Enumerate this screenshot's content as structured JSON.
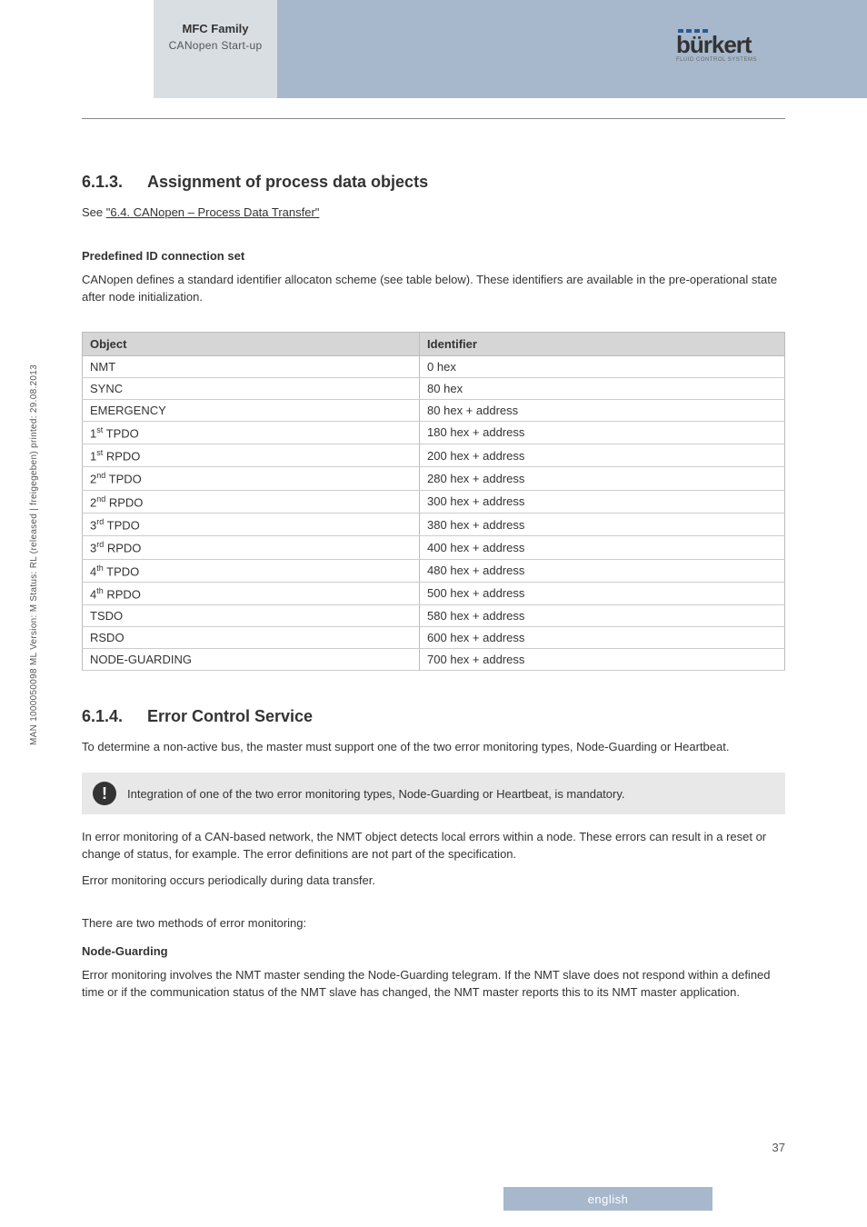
{
  "header": {
    "title": "MFC Family",
    "subtitle": "CANopen Start-up",
    "logo_word": "bürkert",
    "logo_sub": "FLUID CONTROL SYSTEMS"
  },
  "side_text": "MAN 1000050098 ML Version: M Status: RL (released | freigegeben) printed: 29.08.2013",
  "sec613": {
    "num": "6.1.3.",
    "title": "Assignment of process data objects",
    "see_label": "See ",
    "see_link": "\"6.4. CANopen – Process Data Transfer\"",
    "predefined_heading": "Predefined ID connection set",
    "predefined_text": "CANopen defines a standard identifier allocaton scheme (see table below). These identifiers are available in the pre-operational state after node initialization."
  },
  "table": {
    "head_object": "Object",
    "head_identifier": "Identifier",
    "rows": [
      {
        "obj_pre": "",
        "obj_sup": "",
        "obj_post": "NMT",
        "id": "0 hex"
      },
      {
        "obj_pre": "",
        "obj_sup": "",
        "obj_post": "SYNC",
        "id": "80 hex"
      },
      {
        "obj_pre": "",
        "obj_sup": "",
        "obj_post": "EMERGENCY",
        "id": "80 hex + address"
      },
      {
        "obj_pre": "1",
        "obj_sup": "st",
        "obj_post": " TPDO",
        "id": "180 hex + address"
      },
      {
        "obj_pre": "1",
        "obj_sup": "st",
        "obj_post": " RPDO",
        "id": "200 hex + address"
      },
      {
        "obj_pre": "2",
        "obj_sup": "nd",
        "obj_post": " TPDO",
        "id": "280 hex + address"
      },
      {
        "obj_pre": "2",
        "obj_sup": "nd",
        "obj_post": " RPDO",
        "id": "300 hex + address"
      },
      {
        "obj_pre": "3",
        "obj_sup": "rd",
        "obj_post": " TPDO",
        "id": "380 hex + address"
      },
      {
        "obj_pre": "3",
        "obj_sup": "rd",
        "obj_post": " RPDO",
        "id": "400 hex + address"
      },
      {
        "obj_pre": "4",
        "obj_sup": "th",
        "obj_post": " TPDO",
        "id": "480 hex + address"
      },
      {
        "obj_pre": "4",
        "obj_sup": "th",
        "obj_post": " RPDO",
        "id": "500 hex + address"
      },
      {
        "obj_pre": "",
        "obj_sup": "",
        "obj_post": "TSDO",
        "id": "580 hex + address"
      },
      {
        "obj_pre": "",
        "obj_sup": "",
        "obj_post": "RSDO",
        "id": "600 hex + address"
      },
      {
        "obj_pre": "",
        "obj_sup": "",
        "obj_post": "NODE-GUARDING",
        "id": "700 hex + address"
      }
    ]
  },
  "sec614": {
    "num": "6.1.4.",
    "title": "Error Control Service",
    "p1": "To determine a non-active bus, the master must support one of the two error monitoring types, Node-Guarding or Heartbeat.",
    "notice": "Integration of one of the two error monitoring types, Node-Guarding or Heartbeat, is mandatory.",
    "p2": "In error monitoring of a CAN-based network, the NMT object detects local errors within a node. These errors can result in a reset or change of status, for example. The error definitions are not part of the specification.",
    "p3": "Error monitoring occurs periodically during data transfer.",
    "p4": "There are two methods of error monitoring:",
    "ng_heading": "Node-Guarding",
    "ng_text": "Error monitoring involves the NMT master sending the Node-Guarding telegram. If the NMT slave does not respond within a defined time or if the communication status of the NMT slave has changed, the NMT master reports this to its NMT master application."
  },
  "page_number": "37",
  "language": "english"
}
